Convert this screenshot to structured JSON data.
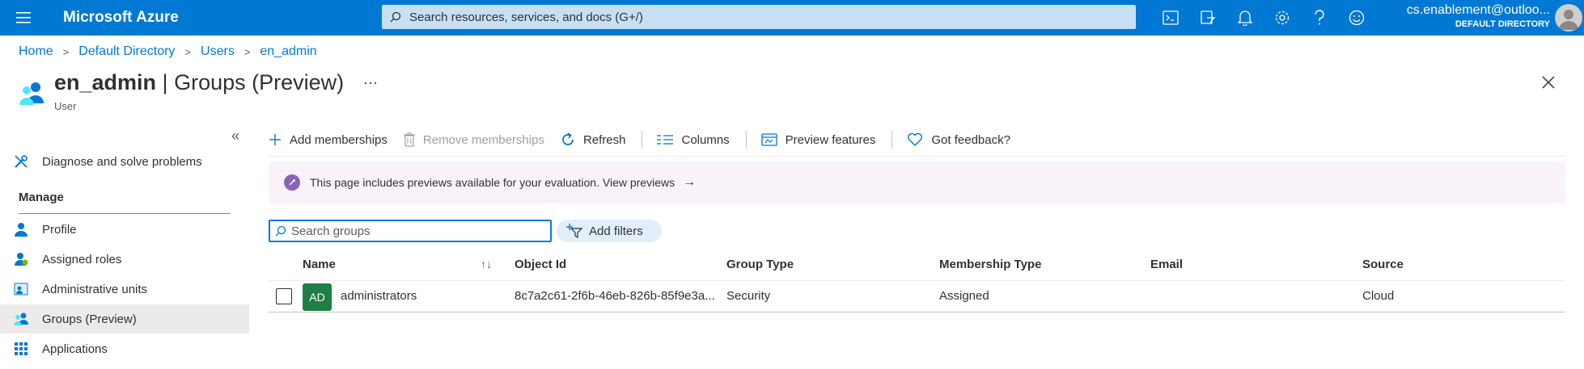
{
  "header": {
    "brand": "Microsoft Azure",
    "search_placeholder": "Search resources, services, and docs (G+/)",
    "icons": [
      "cloud-shell-icon",
      "directory-filter-icon",
      "bell-icon",
      "gear-icon",
      "help-icon",
      "feedback-smiley-icon"
    ],
    "account_email": "cs.enablement@outloo...",
    "account_directory": "DEFAULT DIRECTORY"
  },
  "breadcrumb": [
    "Home",
    "Default Directory",
    "Users",
    "en_admin"
  ],
  "page": {
    "title_entity": "en_admin",
    "title_separator": " | ",
    "title_section": "Groups (Preview)",
    "subtitle": "User",
    "more": "···"
  },
  "sidebar": {
    "collapse_glyph": "«",
    "diagnose": "Diagnose and solve problems",
    "manage_heading": "Manage",
    "items": [
      {
        "label": "Profile",
        "icon": "user-icon"
      },
      {
        "label": "Assigned roles",
        "icon": "assigned-roles-icon"
      },
      {
        "label": "Administrative units",
        "icon": "admin-units-icon"
      },
      {
        "label": "Groups (Preview)",
        "icon": "groups-icon",
        "active": true
      },
      {
        "label": "Applications",
        "icon": "applications-grid-icon"
      }
    ]
  },
  "commands": {
    "add": "Add memberships",
    "remove": "Remove memberships",
    "refresh": "Refresh",
    "columns": "Columns",
    "preview": "Preview features",
    "feedback": "Got feedback?"
  },
  "banner": {
    "text": "This page includes previews available for your evaluation. View previews",
    "arrow": "→"
  },
  "toolbar": {
    "search_placeholder": "Search groups",
    "search_value": "",
    "filters_label": "Add filters"
  },
  "table": {
    "columns": [
      "Name",
      "Object Id",
      "Group Type",
      "Membership Type",
      "Email",
      "Source"
    ],
    "sort_glyph": "↑↓",
    "rows": [
      {
        "initials": "AD",
        "name": "administrators",
        "object_id": "8c7a2c61-2f6b-46eb-826b-85f9e3a...",
        "group_type": "Security",
        "membership_type": "Assigned",
        "email": "",
        "source": "Cloud"
      }
    ]
  },
  "colors": {
    "accent": "#0078d4",
    "search_bg": "#c7e0f4",
    "banner_bg": "#f9f3f9",
    "banner_icon": "#8764b8",
    "group_avatar": "#1e7f46",
    "active_nav": "#edebe9"
  }
}
